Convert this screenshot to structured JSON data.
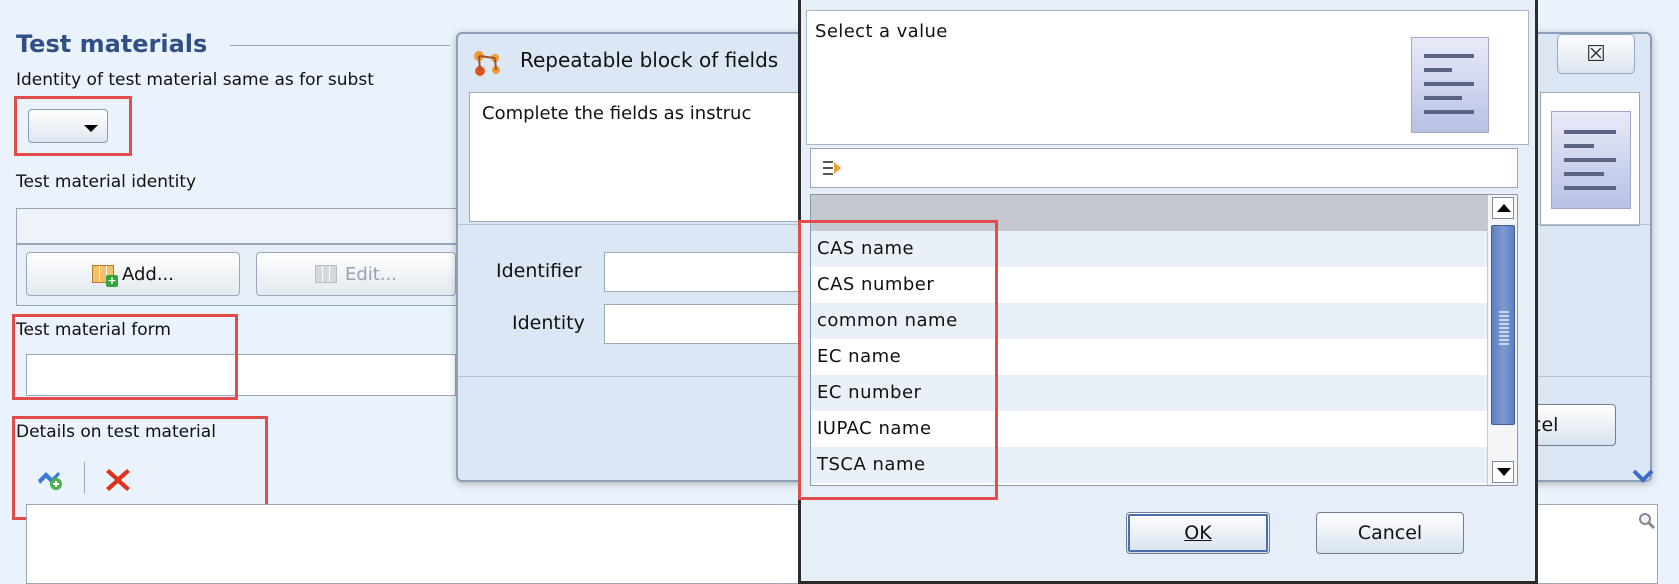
{
  "test_materials": {
    "title": "Test materials",
    "identity_same_label": "Identity of test material same as for subst",
    "identity_label": "Test material identity",
    "add_button": "Add...",
    "edit_button": "Edit...",
    "form_label": "Test material form",
    "details_label": "Details on test material"
  },
  "repeatable_dialog": {
    "title": "Repeatable block of fields",
    "instructions": "Complete the fields as instruc",
    "identifier_label": "Identifier",
    "identity_label": "Identity",
    "cancel_button_partial": "ncel",
    "close_glyph": "☒"
  },
  "select_dialog": {
    "title": "Select a value",
    "filter_value": "",
    "options": [
      "",
      "CAS name",
      "CAS number",
      "common name",
      "EC name",
      "EC number",
      "IUPAC name",
      "TSCA name"
    ],
    "ok_button": "OK",
    "cancel_button": "Cancel"
  },
  "colors": {
    "highlight": "#e14c4c",
    "background": "#eaf2fb",
    "title": "#2f4f86"
  }
}
